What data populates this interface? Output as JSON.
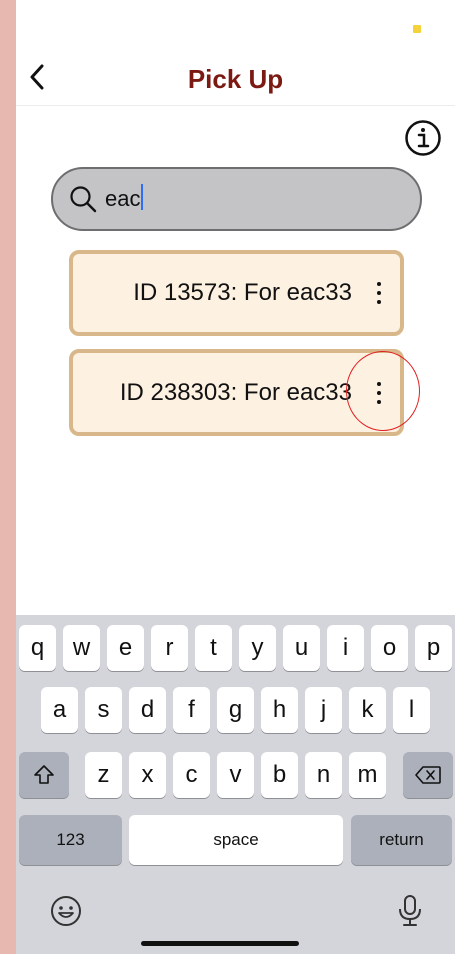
{
  "nav": {
    "title": "Pick Up"
  },
  "search": {
    "value": "eac"
  },
  "results": [
    {
      "label": "ID 13573: For eac33"
    },
    {
      "label": "ID 238303: For eac33"
    }
  ],
  "keyboard": {
    "row1": [
      "q",
      "w",
      "e",
      "r",
      "t",
      "y",
      "u",
      "i",
      "o",
      "p"
    ],
    "row2": [
      "a",
      "s",
      "d",
      "f",
      "g",
      "h",
      "j",
      "k",
      "l"
    ],
    "row3": [
      "z",
      "x",
      "c",
      "v",
      "b",
      "n",
      "m"
    ],
    "numbers_label": "123",
    "space_label": "space",
    "return_label": "return"
  },
  "colors": {
    "title": "#7a1a12",
    "card_background": "#fdf1e2",
    "card_border": "#d8b88a",
    "highlight": "#e02020",
    "side_background": "#e6b8b0"
  }
}
